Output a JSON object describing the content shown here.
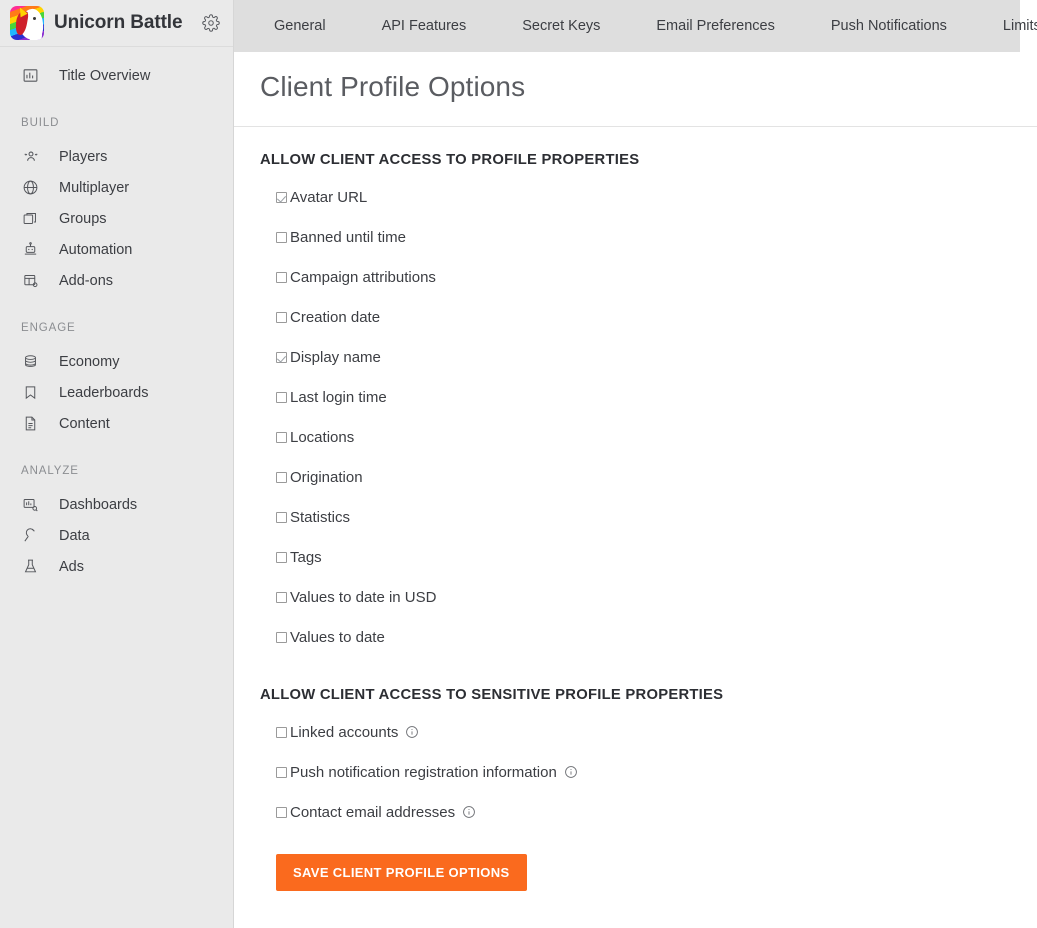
{
  "brand": {
    "title": "Unicorn Battle",
    "logo_icon": "unicorn-logo-icon",
    "settings_icon": "gear-icon"
  },
  "sidebar": {
    "top_items": [
      {
        "label": "Title Overview",
        "icon": "bar-chart-icon",
        "name": "title-overview"
      }
    ],
    "sections": [
      {
        "label": "BUILD",
        "items": [
          {
            "label": "Players",
            "icon": "players-icon",
            "name": "players"
          },
          {
            "label": "Multiplayer",
            "icon": "globe-icon",
            "name": "multiplayer"
          },
          {
            "label": "Groups",
            "icon": "copy-windows-icon",
            "name": "groups"
          },
          {
            "label": "Automation",
            "icon": "robot-icon",
            "name": "automation"
          },
          {
            "label": "Add-ons",
            "icon": "addons-grid-icon",
            "name": "add-ons"
          }
        ]
      },
      {
        "label": "ENGAGE",
        "items": [
          {
            "label": "Economy",
            "icon": "coins-stack-icon",
            "name": "economy"
          },
          {
            "label": "Leaderboards",
            "icon": "bookmark-icon",
            "name": "leaderboards"
          },
          {
            "label": "Content",
            "icon": "document-icon",
            "name": "content"
          }
        ]
      },
      {
        "label": "ANALYZE",
        "items": [
          {
            "label": "Dashboards",
            "icon": "dashboard-search-icon",
            "name": "dashboards"
          },
          {
            "label": "Data",
            "icon": "plug-icon",
            "name": "data"
          },
          {
            "label": "Ads",
            "icon": "flask-icon",
            "name": "ads"
          }
        ]
      }
    ]
  },
  "tabs": [
    {
      "label": "General",
      "name": "general",
      "active": false
    },
    {
      "label": "API Features",
      "name": "api-features",
      "active": false
    },
    {
      "label": "Secret Keys",
      "name": "secret-keys",
      "active": false
    },
    {
      "label": "Email Preferences",
      "name": "email-preferences",
      "active": false
    },
    {
      "label": "Push Notifications",
      "name": "push-notifications",
      "active": false
    },
    {
      "label": "Limits",
      "name": "limits",
      "active": false
    }
  ],
  "page": {
    "title": "Client Profile Options"
  },
  "sections": {
    "profile_properties": {
      "heading": "ALLOW CLIENT ACCESS TO PROFILE PROPERTIES",
      "options": [
        {
          "label": "Avatar URL",
          "checked": true,
          "info": false
        },
        {
          "label": "Banned until time",
          "checked": false,
          "info": false
        },
        {
          "label": "Campaign attributions",
          "checked": false,
          "info": false
        },
        {
          "label": "Creation date",
          "checked": false,
          "info": false
        },
        {
          "label": "Display name",
          "checked": true,
          "info": false
        },
        {
          "label": "Last login time",
          "checked": false,
          "info": false
        },
        {
          "label": "Locations",
          "checked": false,
          "info": false
        },
        {
          "label": "Origination",
          "checked": false,
          "info": false
        },
        {
          "label": "Statistics",
          "checked": false,
          "info": false
        },
        {
          "label": "Tags",
          "checked": false,
          "info": false
        },
        {
          "label": "Values to date in USD",
          "checked": false,
          "info": false
        },
        {
          "label": "Values to date",
          "checked": false,
          "info": false
        }
      ]
    },
    "sensitive_properties": {
      "heading": "ALLOW CLIENT ACCESS TO SENSITIVE PROFILE PROPERTIES",
      "options": [
        {
          "label": "Linked accounts",
          "checked": false,
          "info": true
        },
        {
          "label": "Push notification registration information",
          "checked": false,
          "info": true
        },
        {
          "label": "Contact email addresses",
          "checked": false,
          "info": true
        }
      ]
    }
  },
  "actions": {
    "save_label": "SAVE CLIENT PROFILE OPTIONS"
  },
  "colors": {
    "accent_orange": "#fa6a1e",
    "sidebar_bg": "#eaeaea",
    "tabbar_bg": "#dedede",
    "text_primary": "#3c3e43",
    "title_gray": "#5a5c61"
  }
}
